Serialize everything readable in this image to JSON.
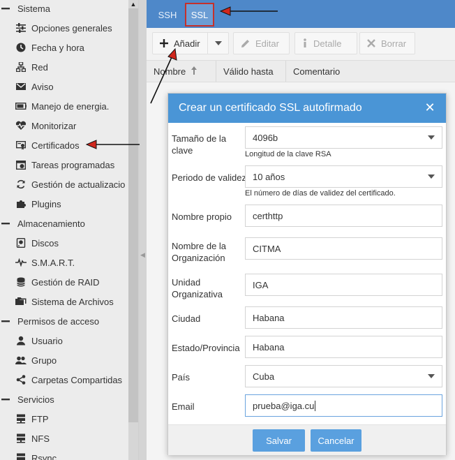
{
  "sidebar": {
    "groups": [
      {
        "label": "Sistema",
        "items": [
          "Opciones generales",
          "Fecha y hora",
          "Red",
          "Aviso",
          "Manejo de energia.",
          "Monitorizar",
          "Certificados",
          "Tareas programadas",
          "Gestión de actualizacio",
          "Plugins"
        ]
      },
      {
        "label": "Almacenamiento",
        "items": [
          "Discos",
          "S.M.A.R.T.",
          "Gestión de RAID",
          "Sistema de Archivos"
        ]
      },
      {
        "label": "Permisos de acceso",
        "items": [
          "Usuario",
          "Grupo",
          "Carpetas Compartidas"
        ]
      },
      {
        "label": "Servicios",
        "items": [
          "FTP",
          "NFS",
          "Rsync"
        ]
      }
    ]
  },
  "tabs": {
    "ssh": "SSH",
    "ssl": "SSL",
    "active": "SSL"
  },
  "toolbar": {
    "add": "Añadir",
    "edit": "Editar",
    "detail": "Detalle",
    "delete": "Borrar"
  },
  "grid": {
    "columns": [
      "Nombre",
      "Válido hasta",
      "Comentario"
    ]
  },
  "dialog": {
    "title": "Crear un certificado SSL autofirmado",
    "fields": {
      "key_size": {
        "label": "Tamaño de la clave",
        "value": "4096b",
        "hint": "Longitud de la clave RSA"
      },
      "validity": {
        "label": "Periodo de validez",
        "value": "10 años",
        "hint": "El número de días de validez del certificado."
      },
      "common_name": {
        "label": "Nombre propio",
        "value": "certhttp"
      },
      "organization": {
        "label": "Nombre de la Organización",
        "value": "CITMA"
      },
      "unit": {
        "label": "Unidad Organizativa",
        "value": "IGA"
      },
      "city": {
        "label": "Ciudad",
        "value": "Habana"
      },
      "state": {
        "label": "Estado/Provincia",
        "value": "Habana"
      },
      "country": {
        "label": "País",
        "value": "Cuba"
      },
      "email": {
        "label": "Email",
        "value": "prueba@iga.cu"
      }
    },
    "save": "Salvar",
    "cancel": "Cancelar"
  },
  "colors": {
    "accent": "#4a95d6",
    "tabbar": "#4e88c9",
    "annotation": "#c5302a"
  }
}
